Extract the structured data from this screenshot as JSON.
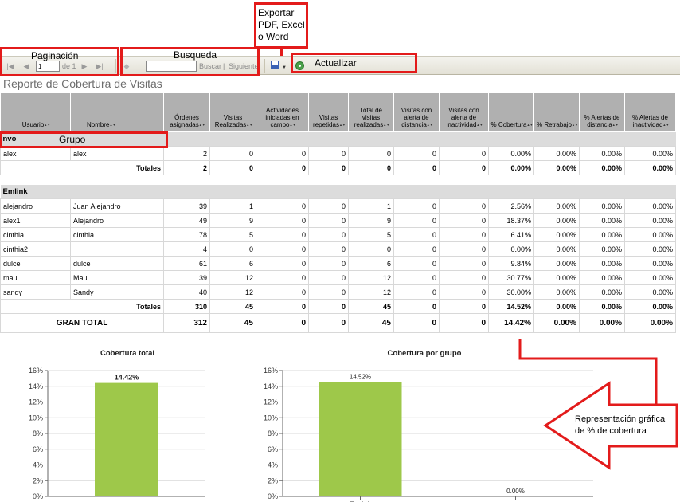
{
  "annotations": {
    "paginacion": "Paginación",
    "busqueda": "Busqueda",
    "exportar": [
      "Exportar",
      "PDF, Excel",
      "o Word"
    ],
    "actualizar": "Actualizar",
    "grupo": "Grupo",
    "representacion": [
      "Representación gráfica",
      "de % de cobertura"
    ]
  },
  "toolbar": {
    "page_value": "1",
    "page_of": "de 1",
    "search_placeholder": "",
    "buscar": "Buscar",
    "separator": "|",
    "siguiente": "Siguiente"
  },
  "report_title": "Reporte de Cobertura de Visitas",
  "columns": [
    "Usuario",
    "Nombre",
    "Órdenes asignadas",
    "Visitas Realizadas",
    "Actividades iniciadas en campo",
    "Visitas repetidas",
    "Total de visitas realizadas",
    "Visitas con alerta de distancia",
    "Visitas con alerta de inactividad",
    "% Cobertura",
    "% Retrabajo",
    "% Alertas de distancia",
    "% Alertas de inactividad"
  ],
  "groups": [
    {
      "name": "nvo",
      "rows": [
        [
          "alex",
          "alex",
          "2",
          "0",
          "0",
          "0",
          "0",
          "0",
          "0",
          "0.00%",
          "0.00%",
          "0.00%",
          "0.00%"
        ]
      ],
      "totals": [
        "Totales",
        "2",
        "0",
        "0",
        "0",
        "0",
        "0",
        "0",
        "0.00%",
        "0.00%",
        "0.00%",
        "0.00%"
      ]
    },
    {
      "name": "Emlink",
      "rows": [
        [
          "alejandro",
          "Juan Alejandro",
          "39",
          "1",
          "0",
          "0",
          "1",
          "0",
          "0",
          "2.56%",
          "0.00%",
          "0.00%",
          "0.00%"
        ],
        [
          "alex1",
          "Alejandro",
          "49",
          "9",
          "0",
          "0",
          "9",
          "0",
          "0",
          "18.37%",
          "0.00%",
          "0.00%",
          "0.00%"
        ],
        [
          "cinthia",
          "cinthia",
          "78",
          "5",
          "0",
          "0",
          "5",
          "0",
          "0",
          "6.41%",
          "0.00%",
          "0.00%",
          "0.00%"
        ],
        [
          "cinthia2",
          "",
          "4",
          "0",
          "0",
          "0",
          "0",
          "0",
          "0",
          "0.00%",
          "0.00%",
          "0.00%",
          "0.00%"
        ],
        [
          "dulce",
          "dulce",
          "61",
          "6",
          "0",
          "0",
          "6",
          "0",
          "0",
          "9.84%",
          "0.00%",
          "0.00%",
          "0.00%"
        ],
        [
          "mau",
          "Mau",
          "39",
          "12",
          "0",
          "0",
          "12",
          "0",
          "0",
          "30.77%",
          "0.00%",
          "0.00%",
          "0.00%"
        ],
        [
          "sandy",
          "Sandy",
          "40",
          "12",
          "0",
          "0",
          "12",
          "0",
          "0",
          "30.00%",
          "0.00%",
          "0.00%",
          "0.00%"
        ]
      ],
      "totals": [
        "Totales",
        "310",
        "45",
        "0",
        "0",
        "45",
        "0",
        "0",
        "14.52%",
        "0.00%",
        "0.00%",
        "0.00%"
      ]
    }
  ],
  "grand_total": [
    "GRAN TOTAL",
    "312",
    "45",
    "0",
    "0",
    "45",
    "0",
    "0",
    "14.42%",
    "0.00%",
    "0.00%",
    "0.00%"
  ],
  "colors": {
    "bar": "#9ec84a",
    "annotation": "#e31b1b",
    "header": "#b0b0b0",
    "group": "#dcdcdc"
  },
  "chart_data": [
    {
      "type": "bar",
      "title": "Cobertura total",
      "categories": [
        ""
      ],
      "values": [
        14.42
      ],
      "labels": [
        "14.42%"
      ],
      "ylim": [
        0,
        16
      ],
      "yticks": [
        "0%",
        "2%",
        "4%",
        "6%",
        "8%",
        "10%",
        "12%",
        "14%",
        "16%"
      ],
      "grid": true
    },
    {
      "type": "bar",
      "title": "Cobertura por grupo",
      "categories": [
        "Emlink",
        "nvo"
      ],
      "values": [
        14.52,
        0.0
      ],
      "labels": [
        "14.52%",
        "0.00%"
      ],
      "ylim": [
        0,
        16
      ],
      "yticks": [
        "0%",
        "2%",
        "4%",
        "6%",
        "8%",
        "10%",
        "12%",
        "14%",
        "16%"
      ],
      "grid": true
    }
  ]
}
